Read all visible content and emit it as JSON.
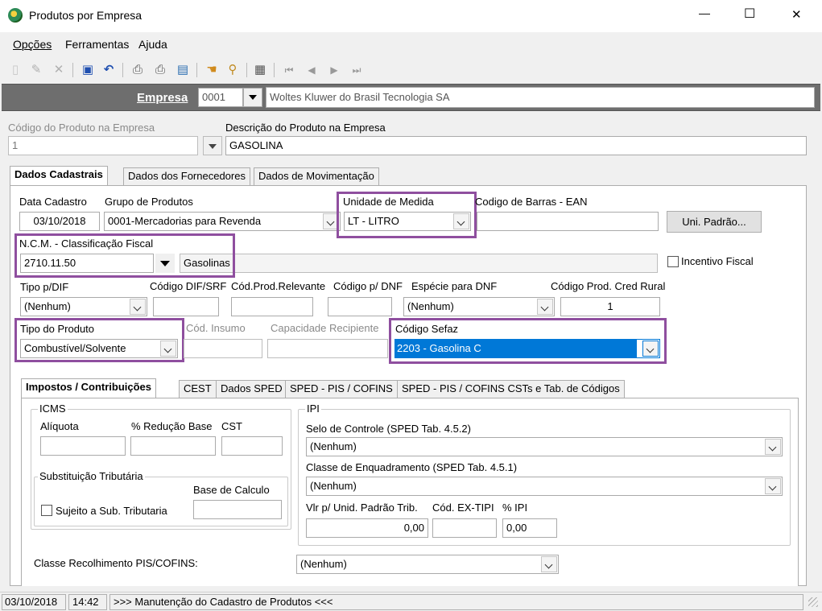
{
  "window": {
    "title": "Produtos por Empresa",
    "minimize": "—",
    "maximize": "☐",
    "close": "✕"
  },
  "menu": {
    "items": [
      {
        "label": "Opções"
      },
      {
        "label": "Ferramentas"
      },
      {
        "label": "Ajuda"
      }
    ]
  },
  "toolbar": {
    "icons": [
      "new-doc-icon",
      "edit-icon",
      "delete-icon",
      "save-icon",
      "undo-icon",
      "print-icon",
      "print-preview-icon",
      "export-icon",
      "search-hand-icon",
      "find-icon",
      "properties-icon",
      "first-record-icon",
      "prev-record-icon",
      "next-record-icon",
      "last-record-icon"
    ]
  },
  "empresa": {
    "label": "Empresa",
    "code": "0001",
    "name": "Woltes Kluwer do Brasil Tecnologia SA"
  },
  "produto": {
    "codigo_label": "Código do Produto na Empresa",
    "codigo_value": "1",
    "descricao_label": "Descrição do Produto na Empresa",
    "descricao_value": "GASOLINA"
  },
  "main_tabs": [
    {
      "label": "Dados Cadastrais"
    },
    {
      "label": "Dados dos Fornecedores"
    },
    {
      "label": "Dados de Movimentação"
    }
  ],
  "cadastro": {
    "data_label": "Data Cadastro",
    "data_value": "03/10/2018",
    "grupo_label": "Grupo de Produtos",
    "grupo_value": "0001-Mercadorias para Revenda",
    "unidade_label": "Unidade de Medida",
    "unidade_value": "LT - LITRO",
    "ean_label": "Codigo de Barras - EAN",
    "ean_value": "",
    "uni_padrao_button": "Uni. Padrão...",
    "ncm_label": "N.C.M. -  Classificação Fiscal",
    "ncm_value": "2710.11.50",
    "ncm_desc": "Gasolinas",
    "incentivo_label": "Incentivo Fiscal",
    "tipo_dif_label": "Tipo p/DIF",
    "tipo_dif_value": "(Nenhum)",
    "cod_dif_label": "Código DIF/SRF",
    "cod_prod_relevante_label": "Cód.Prod.Relevante",
    "cod_dnf_label": "Código p/ DNF",
    "especie_dnf_label": "Espécie para DNF",
    "especie_dnf_value": "(Nenhum)",
    "cod_cred_rural_label": "Código Prod. Cred Rural",
    "cod_cred_rural_value": "1",
    "tipo_produto_label": "Tipo do Produto",
    "tipo_produto_value": "Combustível/Solvente",
    "cod_insumo_label": "Cód. Insumo",
    "capacidade_label": "Capacidade Recipiente",
    "codigo_sefaz_label": "Código Sefaz",
    "codigo_sefaz_value": "2203 - Gasolina C"
  },
  "sub_tabs": [
    {
      "label": "Impostos / Contribuições"
    },
    {
      "label": "CEST"
    },
    {
      "label": "Dados SPED"
    },
    {
      "label": "SPED - PIS / COFINS"
    },
    {
      "label": "SPED - PIS / COFINS CSTs e Tab. de Códigos"
    }
  ],
  "icms": {
    "caption": "ICMS",
    "aliquota_label": "Alíquota",
    "reducao_label": "% Redução Base",
    "cst_label": "CST",
    "subst_caption": "Substituição Tributária",
    "base_calculo_label": "Base de Calculo",
    "sujeito_label": "Sujeito a Sub. Tributaria"
  },
  "ipi": {
    "caption": "IPI",
    "selo_label": "Selo de Controle (SPED Tab. 4.5.2)",
    "selo_value": "(Nenhum)",
    "classe_label": "Classe de Enquadramento (SPED Tab. 4.5.1)",
    "classe_value": "(Nenhum)",
    "vlr_label": "Vlr p/ Unid. Padrão Trib.",
    "vlr_value": "0,00",
    "ex_tipi_label": "Cód. EX-TIPI",
    "pct_ipi_label": "% IPI",
    "pct_ipi_value": "0,00"
  },
  "pis_cofins": {
    "label": "Classe Recolhimento PIS/COFINS:",
    "value": "(Nenhum)"
  },
  "status": {
    "date": "03/10/2018",
    "time": "14:42",
    "message": ">>> Manutenção do Cadastro de Produtos <<<"
  },
  "colors": {
    "highlight": "#8f4f9f",
    "selection": "#0078d7",
    "empresa_bar": "#6e6e6e"
  }
}
